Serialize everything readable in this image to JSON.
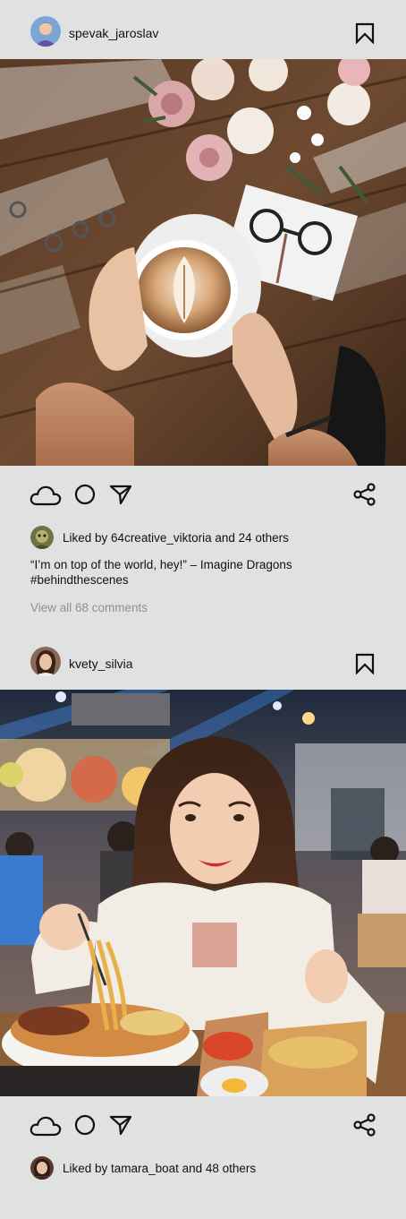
{
  "posts": [
    {
      "username": "spevak_jaroslav",
      "photo": "coffee-latte-art-wooden-table",
      "liked_by_prefix": "Liked by ",
      "liked_by_user": "64creative_viktoria",
      "liked_by_suffix": " and 24 others",
      "caption_line1": "“I’m on top of the world, hey!” – Imagine Dragons",
      "caption_line2": "#behindthescenes",
      "comments_link": "View all 68 comments"
    },
    {
      "username": "kvety_silvia",
      "photo": "woman-eating-noodles-food-court",
      "liked_by_prefix": "Liked by ",
      "liked_by_user": "tamara_boat",
      "liked_by_suffix": " and 48 others"
    }
  ],
  "icons": {
    "like": "cloud-icon",
    "comment": "circle-icon",
    "send": "send-arrow-icon",
    "share": "share-icon",
    "save": "bookmark-icon"
  },
  "colors": {
    "background": "#dfe2e1",
    "text": "#111111",
    "muted": "#8e9190"
  }
}
